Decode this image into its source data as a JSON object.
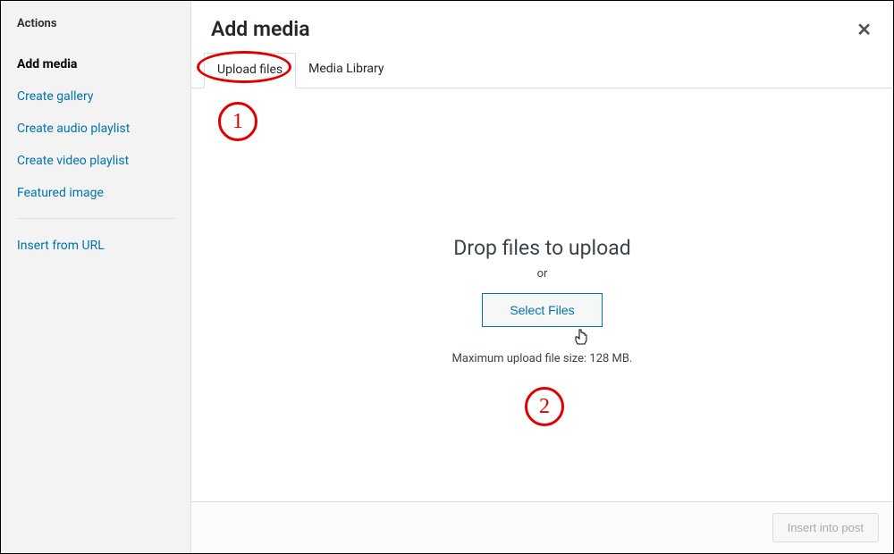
{
  "sidebar": {
    "title": "Actions",
    "items": [
      {
        "label": "Add media",
        "active": true
      },
      {
        "label": "Create gallery",
        "active": false
      },
      {
        "label": "Create audio playlist",
        "active": false
      },
      {
        "label": "Create video playlist",
        "active": false
      },
      {
        "label": "Featured image",
        "active": false
      }
    ],
    "secondary": [
      {
        "label": "Insert from URL"
      }
    ]
  },
  "header": {
    "title": "Add media"
  },
  "tabs": [
    {
      "label": "Upload files",
      "active": true
    },
    {
      "label": "Media Library",
      "active": false
    }
  ],
  "upload": {
    "drop_title": "Drop files to upload",
    "or_text": "or",
    "select_button": "Select Files",
    "max_text": "Maximum upload file size: 128 MB."
  },
  "footer": {
    "insert_button": "Insert into post"
  },
  "annotations": {
    "marker1": "1",
    "marker2": "2"
  }
}
